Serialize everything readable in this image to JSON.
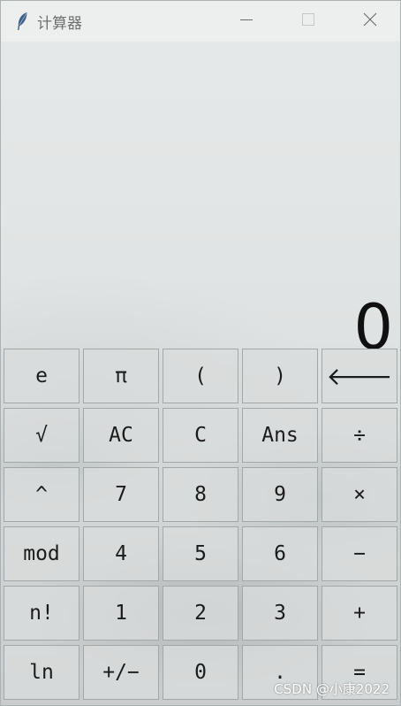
{
  "window": {
    "title": "计算器",
    "icon": "feather-icon"
  },
  "titlebar_controls": [
    {
      "name": "minimize-button",
      "icon": "minimize-icon"
    },
    {
      "name": "maximize-button",
      "icon": "maximize-icon"
    },
    {
      "name": "close-button",
      "icon": "close-icon"
    }
  ],
  "display": {
    "value": "0"
  },
  "keys": [
    {
      "label": "e",
      "name": "key-e"
    },
    {
      "label": "π",
      "name": "key-pi"
    },
    {
      "label": "(",
      "name": "key-open-paren"
    },
    {
      "label": ")",
      "name": "key-close-paren"
    },
    {
      "label": "🡐",
      "name": "key-backspace"
    },
    {
      "label": "√",
      "name": "key-sqrt"
    },
    {
      "label": "AC",
      "name": "key-all-clear"
    },
    {
      "label": "C",
      "name": "key-clear"
    },
    {
      "label": "Ans",
      "name": "key-ans"
    },
    {
      "label": "÷",
      "name": "key-divide"
    },
    {
      "label": "^",
      "name": "key-power"
    },
    {
      "label": "7",
      "name": "key-7"
    },
    {
      "label": "8",
      "name": "key-8"
    },
    {
      "label": "9",
      "name": "key-9"
    },
    {
      "label": "×",
      "name": "key-multiply"
    },
    {
      "label": "mod",
      "name": "key-mod"
    },
    {
      "label": "4",
      "name": "key-4"
    },
    {
      "label": "5",
      "name": "key-5"
    },
    {
      "label": "6",
      "name": "key-6"
    },
    {
      "label": "−",
      "name": "key-subtract"
    },
    {
      "label": "n!",
      "name": "key-factorial"
    },
    {
      "label": "1",
      "name": "key-1"
    },
    {
      "label": "2",
      "name": "key-2"
    },
    {
      "label": "3",
      "name": "key-3"
    },
    {
      "label": "+",
      "name": "key-add"
    },
    {
      "label": "ln",
      "name": "key-ln"
    },
    {
      "label": "+/−",
      "name": "key-negate"
    },
    {
      "label": "0",
      "name": "key-0"
    },
    {
      "label": ".",
      "name": "key-decimal"
    },
    {
      "label": "=",
      "name": "key-equals"
    }
  ],
  "watermark": "CSDN @小康2022",
  "colors": {
    "titlebar": "#edefef",
    "key_border": "#a2a7a8",
    "display_text": "#101010"
  }
}
